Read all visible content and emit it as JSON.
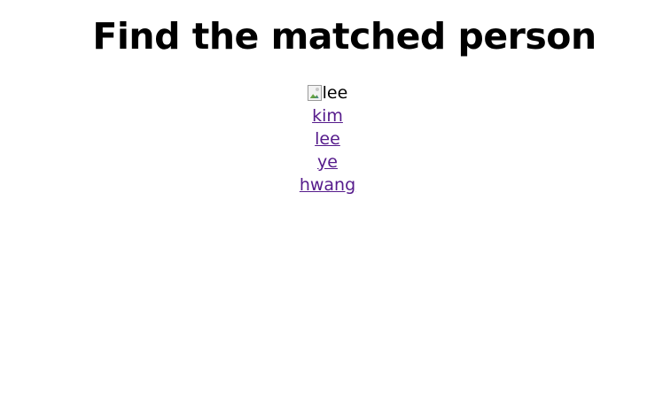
{
  "page": {
    "title": "Find the matched person"
  },
  "image": {
    "alt": "lee",
    "icon": "broken-image-icon"
  },
  "links": [
    {
      "label": "kim"
    },
    {
      "label": "lee"
    },
    {
      "label": "ye"
    },
    {
      "label": "hwang"
    }
  ],
  "colors": {
    "visited_link": "#551a8b",
    "text": "#000000",
    "background": "#ffffff"
  }
}
